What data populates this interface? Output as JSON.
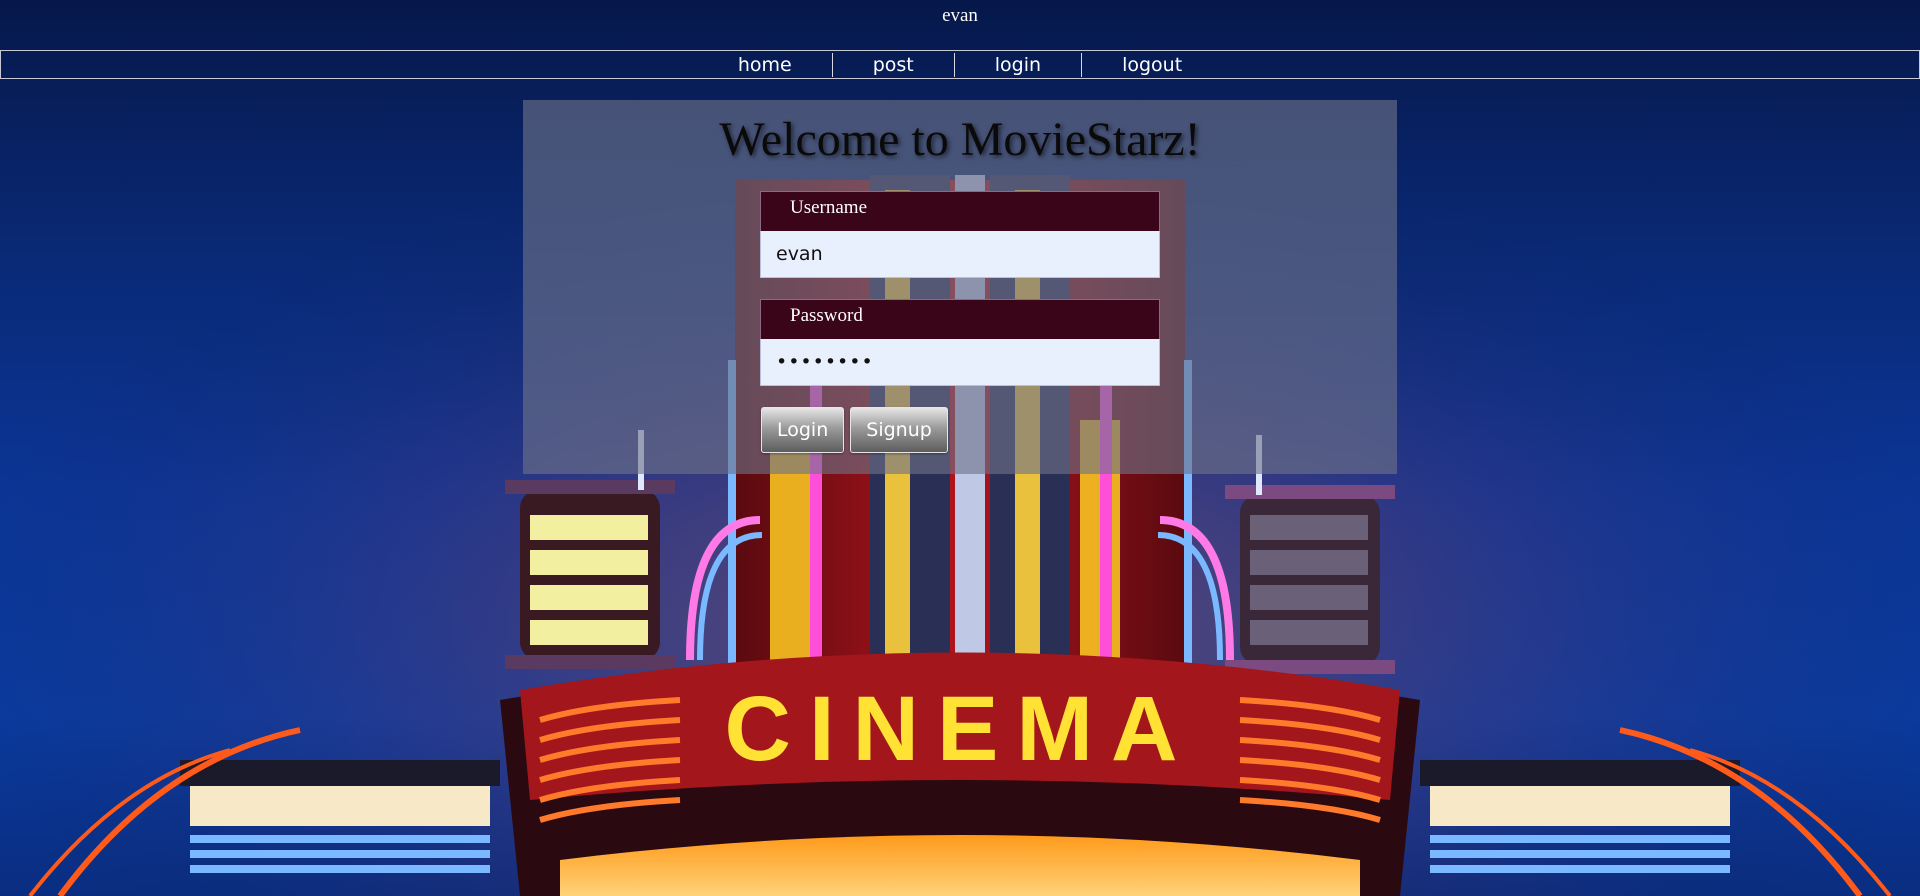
{
  "header": {
    "username": "evan"
  },
  "nav": {
    "items": [
      "home",
      "post",
      "login",
      "logout"
    ]
  },
  "login": {
    "title": "Welcome to MovieStarz!",
    "username_label": "Username",
    "username_value": "evan",
    "password_label": "Password",
    "password_value": "evanevan",
    "login_button": "Login",
    "signup_button": "Signup"
  },
  "background": {
    "sign_text": "CINEMA",
    "sky_color": "#0a3596",
    "neon_colors": [
      "#ffe233",
      "#ff4a1a",
      "#e6104a",
      "#7ab8ff",
      "#ff4fd8"
    ]
  }
}
